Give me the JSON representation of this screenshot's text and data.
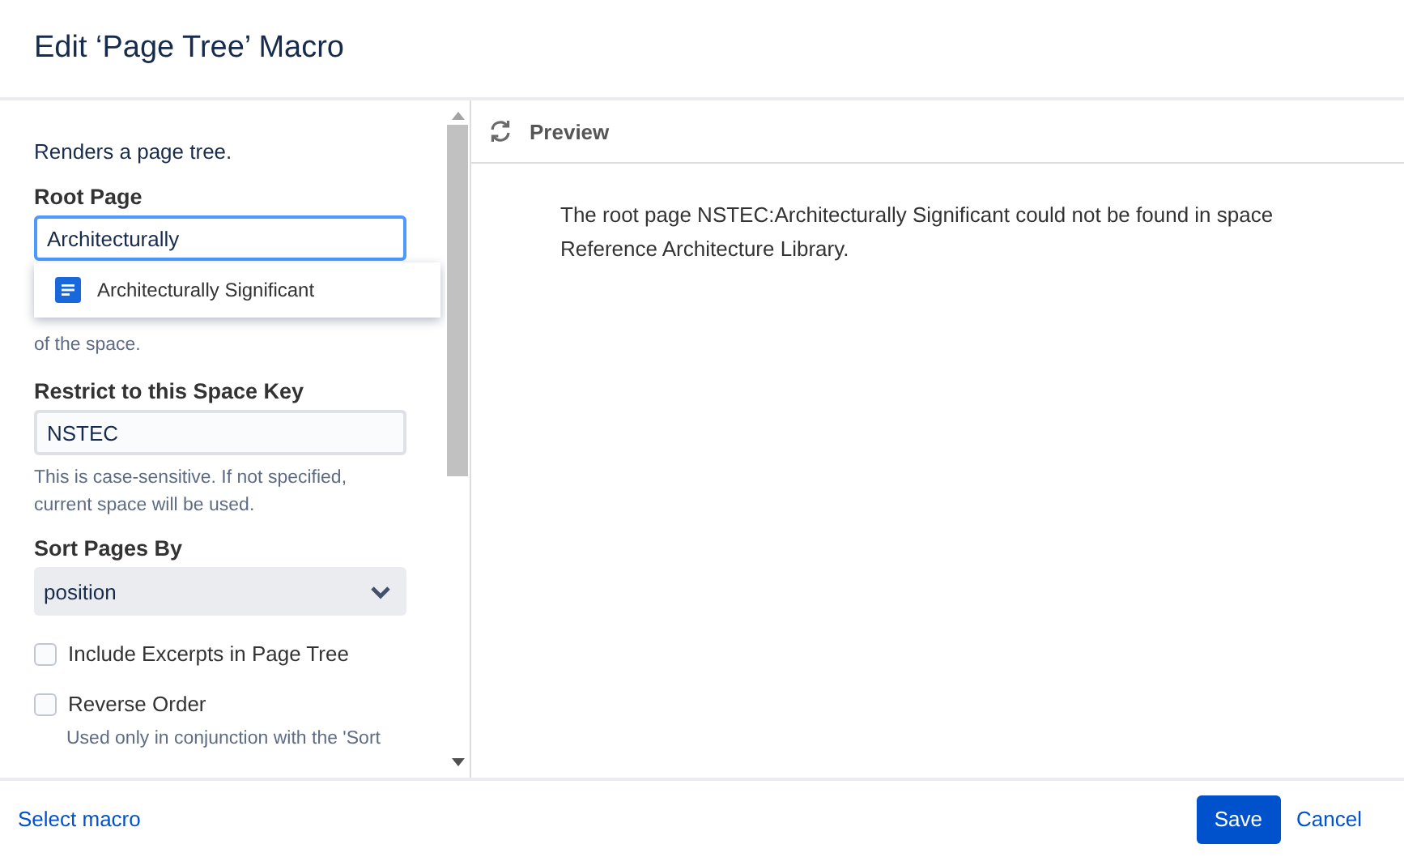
{
  "dialog": {
    "title": "Edit ‘Page Tree’ Macro"
  },
  "form": {
    "description": "Renders a page tree.",
    "root_page": {
      "label": "Root Page",
      "value": "Architecturally",
      "suggestions": [
        {
          "label": "Architecturally Significant",
          "selected": false
        }
      ],
      "help": "of the space."
    },
    "space_key": {
      "label": "Restrict to this Space Key",
      "value": "NSTEC",
      "help": "This is case-sensitive. If not specified, current space will be used."
    },
    "sort": {
      "label": "Sort Pages By",
      "value": "position"
    },
    "options": [
      {
        "label": "Include Excerpts in Page Tree",
        "checked": false
      },
      {
        "label": "Reverse Order",
        "checked": false,
        "help": "Used only in conjunction with the 'Sort"
      }
    ]
  },
  "preview": {
    "title": "Preview",
    "message": "The root page NSTEC:Architecturally Significant could not be found in space Reference Architecture Library."
  },
  "footer": {
    "link": "Select macro",
    "buttons": [
      {
        "label": "Save",
        "kind": "primary"
      },
      {
        "label": "Cancel",
        "kind": "link"
      }
    ]
  }
}
